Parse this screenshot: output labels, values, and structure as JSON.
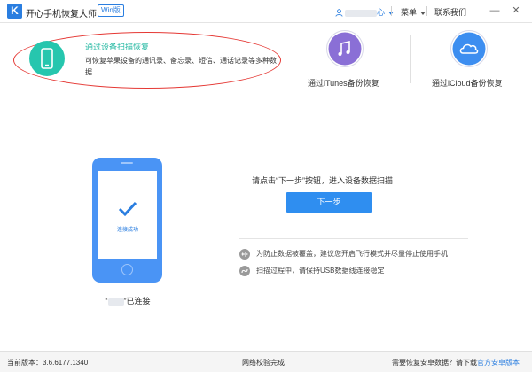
{
  "titlebar": {
    "logo_letter": "K",
    "app_title": "开心手机恢复大师",
    "edition_badge": "Win版",
    "user_suffix": "心",
    "menu_label": "菜单",
    "contact_label": "联系我们",
    "minimize": "—",
    "close": "✕"
  },
  "modes": {
    "device_scan": {
      "title": "通过设备扫描恢复",
      "description": "可恢复苹果设备的通讯录、备忘录、短信、通话记录等多种数据"
    },
    "itunes": {
      "label": "通过iTunes备份恢复"
    },
    "icloud": {
      "label": "通过iCloud备份恢复"
    }
  },
  "main": {
    "phone_status": "连接成功",
    "device_status_prefix": "“",
    "device_status_suffix": "”已连接",
    "instruction": "请点击“下一步”按钮，进入设备数据扫描",
    "next_button": "下一步",
    "tips": [
      "为防止数据被覆盖，建议您开启飞行模式并尽量停止使用手机",
      "扫描过程中，请保持USB数据线连接稳定"
    ]
  },
  "footer": {
    "version_label": "当前版本：3.6.6177.1340",
    "network_status": "网络校验完成",
    "android_prompt": "需要恢复安卓数据？请下载",
    "android_link": "官方安卓版本"
  },
  "colors": {
    "accent_blue": "#2f8ef0",
    "teal": "#26c6ae",
    "purple": "#8a6fd6",
    "annotation_red": "#e53935"
  }
}
